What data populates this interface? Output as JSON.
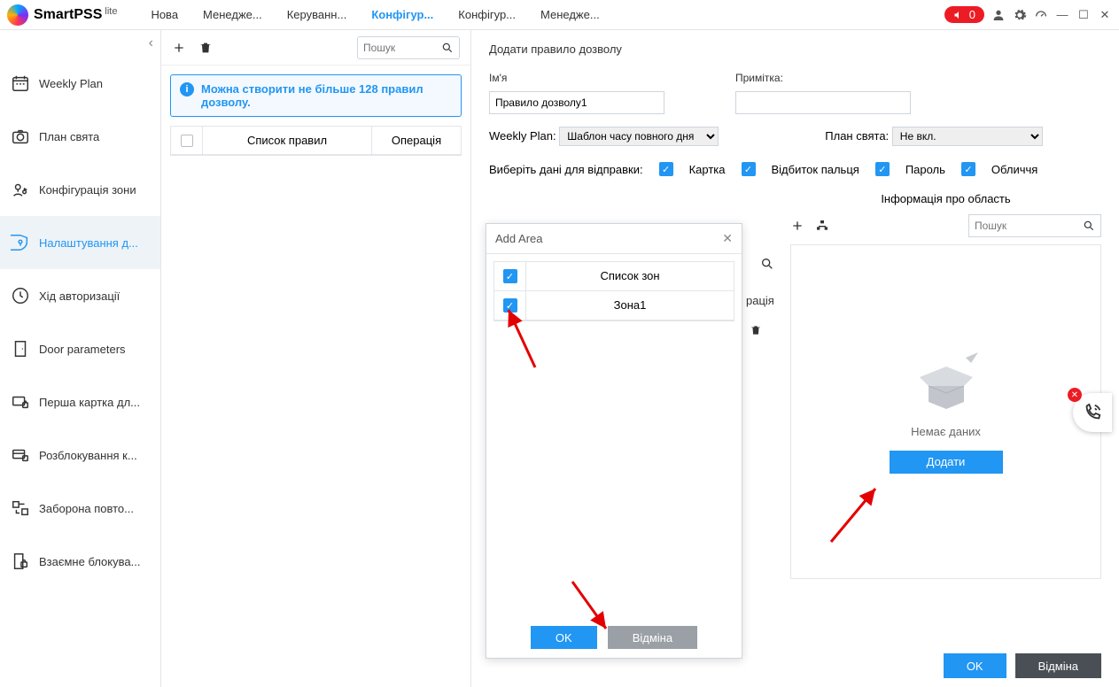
{
  "app": {
    "name": "SmartPSS",
    "suffix": "lite"
  },
  "tabs": [
    "Нова",
    "Менедже...",
    "Керуванн...",
    "Конфігур...",
    "Конфігур...",
    "Менедже..."
  ],
  "activeTab": 3,
  "alertCount": "0",
  "sidebar": {
    "items": [
      {
        "label": "Weekly Plan"
      },
      {
        "label": "План свята"
      },
      {
        "label": "Конфігурація зони"
      },
      {
        "label": "Налаштування д..."
      },
      {
        "label": "Хід авторизації"
      },
      {
        "label": "Door parameters"
      },
      {
        "label": "Перша картка дл..."
      },
      {
        "label": "Розблокування к..."
      },
      {
        "label": "Заборона повто..."
      },
      {
        "label": "Взаємне блокува..."
      }
    ],
    "activeIndex": 3
  },
  "mid": {
    "searchPlaceholder": "Пошук",
    "banner": "Можна створити не більше 128 правил дозволу.",
    "cols": {
      "c1": "Список правил",
      "c2": "Операція"
    }
  },
  "main": {
    "title": "Додати правило дозволу",
    "nameLabel": "Ім'я",
    "nameValue": "Правило дозволу1",
    "noteLabel": "Примітка:",
    "noteValue": "",
    "weeklyPlanLabel": "Weekly Plan:",
    "weeklyPlanValue": "Шаблон часу повного дня",
    "holidayLabel": "План свята:",
    "holidayValue": "Не вкл.",
    "sendLabel": "Виберіть дані для відправки:",
    "checks": [
      "Картка",
      "Відбиток пальця",
      "Пароль",
      "Обличчя"
    ],
    "areaInfoTitle": "Інформація про область",
    "areaSearchPlaceholder": "Пошук",
    "noData": "Немає даних",
    "addBtn": "Додати",
    "ok": "OK",
    "cancel": "Відміна",
    "hiddenOp": "рація"
  },
  "modal": {
    "title": "Add Area",
    "listHeader": "Список зон",
    "row1": "Зона1",
    "ok": "OK",
    "cancel": "Відміна"
  }
}
